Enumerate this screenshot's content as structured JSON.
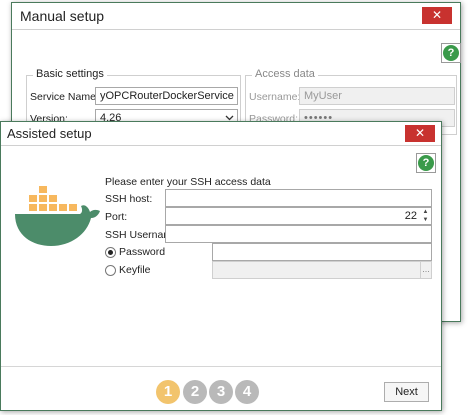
{
  "manual_setup": {
    "title": "Manual setup",
    "close": "✕",
    "help": "?",
    "basic_settings": {
      "caption": "Basic settings",
      "service_name_label": "Service Name:",
      "service_name_value": "yOPCRouterDockerService",
      "version_label": "Version:",
      "version_value": "4.26"
    },
    "access_data": {
      "caption": "Access data",
      "username_label": "Username:",
      "username_value": "MyUser",
      "password_label": "Password:",
      "password_value": "••••••"
    }
  },
  "assisted_setup": {
    "title": "Assisted setup",
    "close": "✕",
    "help": "?",
    "prompt": "Please enter your SSH access data",
    "ssh_host_label": "SSH host:",
    "ssh_host_value": "",
    "port_label": "Port:",
    "port_value": "22",
    "ssh_username_label": "SSH Username:",
    "ssh_username_value": "",
    "password_option_label": "Password",
    "password_value": "",
    "keyfile_option_label": "Keyfile",
    "keyfile_value": "",
    "browse": "...",
    "steps": [
      "1",
      "2",
      "3",
      "4"
    ],
    "next_label": "Next",
    "colors": {
      "step_active": "#f2c46d",
      "step_inactive": "#b9b9b9",
      "whale": "#4c8c6a",
      "containers": "#f7b85e",
      "help": "#3a9a4a",
      "close": "#c8322f",
      "frame": "#4a7a5c"
    }
  }
}
